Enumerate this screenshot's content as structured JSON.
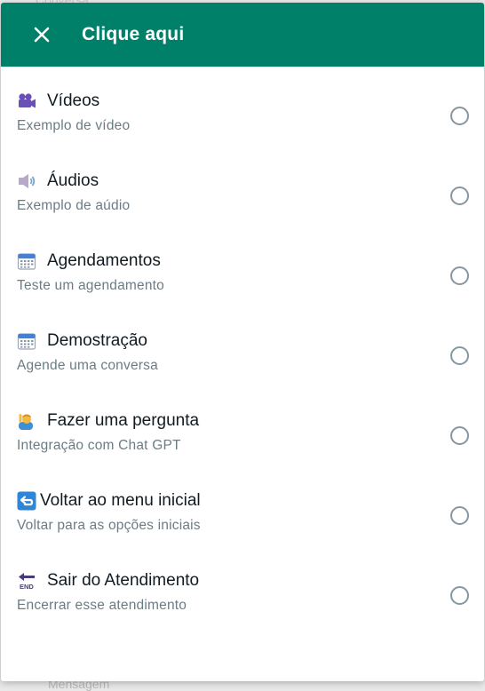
{
  "background": {
    "top_text": "Conversa",
    "bottom_text": "Mensagem"
  },
  "header": {
    "title": "Clique aqui",
    "color": "#008069"
  },
  "options": [
    {
      "icon": "video-camera-icon",
      "title": "Vídeos",
      "subtitle": "Exemplo de vídeo"
    },
    {
      "icon": "speaker-icon",
      "title": "Áudios",
      "subtitle": "Exemplo de aúdio"
    },
    {
      "icon": "calendar-icon",
      "title": "Agendamentos",
      "subtitle": "Teste um agendamento"
    },
    {
      "icon": "calendar-icon",
      "title": "Demostração",
      "subtitle": "Agende uma conversa"
    },
    {
      "icon": "person-raising-hand-icon",
      "title": "Fazer uma pergunta",
      "subtitle": "Integração com Chat GPT"
    },
    {
      "icon": "return-arrow-icon",
      "title": "Voltar ao menu inicial",
      "subtitle": "Voltar para as opções iniciais"
    },
    {
      "icon": "end-arrow-icon",
      "title": "Sair do Atendimento",
      "subtitle": "Encerrar esse atendimento"
    }
  ]
}
